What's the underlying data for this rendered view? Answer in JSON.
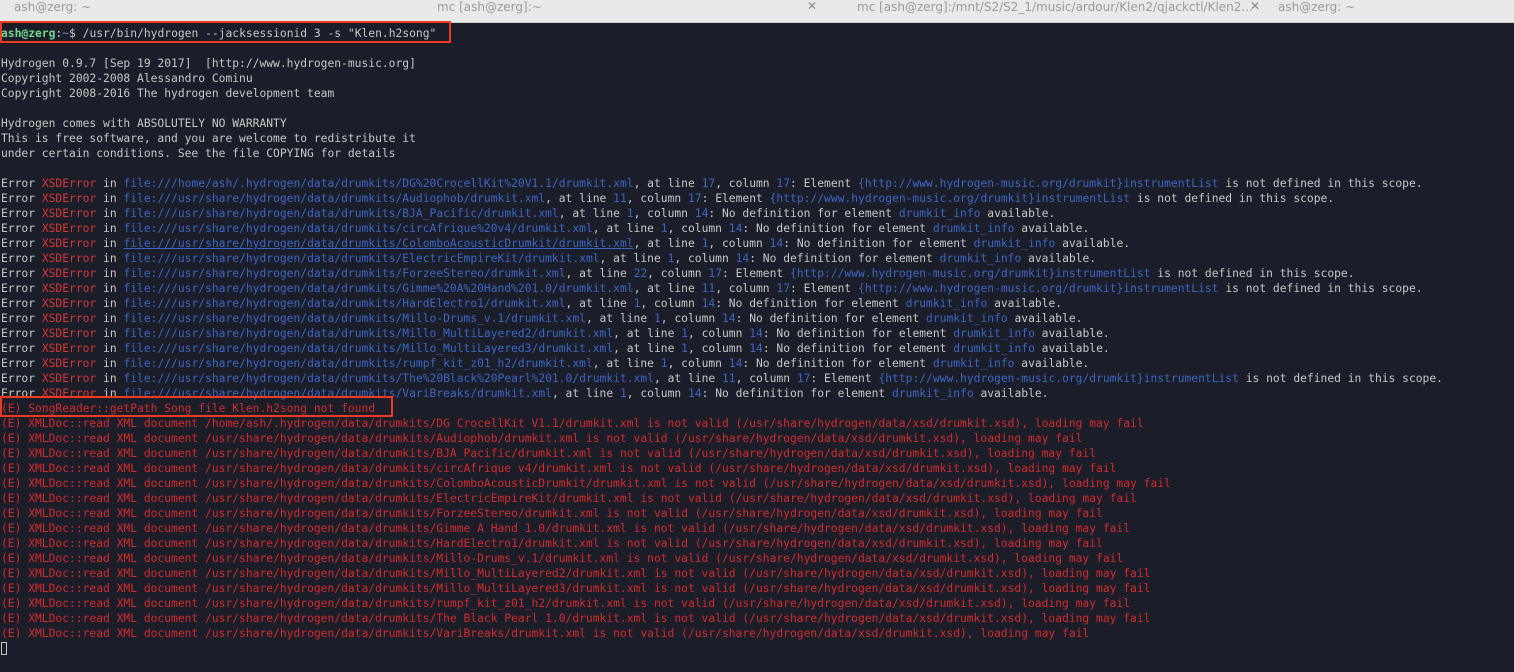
{
  "tabs": [
    {
      "label": "ash@zerg: ~",
      "close": "✕"
    },
    {
      "label": "mc [ash@zerg]:~",
      "close": "✕"
    },
    {
      "label": "mc [ash@zerg]:/mnt/S2/S2_1/music/ardour/Klen2/qjackctl/Klen2...",
      "close": "✕"
    },
    {
      "label": "ash@zerg: ~",
      "close": ""
    }
  ],
  "terminal": {
    "prompt_user": "ash@zerg",
    "prompt_colon": ":",
    "prompt_path": "~",
    "prompt_sym": "$ ",
    "command": "/usr/bin/hydrogen --jacksessionid 3 -s \"Klen.h2song\"",
    "banner": [
      "Hydrogen 0.9.7 [Sep 19 2017]  [http://www.hydrogen-music.org]",
      "Copyright 2002-2008 Alessandro Cominu",
      "Copyright 2008-2016 The hydrogen development team",
      "",
      "Hydrogen comes with ABSOLUTELY NO WARRANTY",
      "This is free software, and you are welcome to redistribute it",
      "under certain conditions. See the file COPYING for details"
    ],
    "errors": [
      {
        "file": "file:///home/ash/.hydrogen/data/drumkits/DG%20CrocellKit%20V1.1/drumkit.xml",
        "line": "17",
        "col": "17",
        "kind": "scope",
        "elem": "{http://www.hydrogen-music.org/drumkit}instrumentList"
      },
      {
        "file": "file:///usr/share/hydrogen/data/drumkits/Audiophob/drumkit.xml",
        "line": "11",
        "col": "17",
        "kind": "scope",
        "elem": "{http://www.hydrogen-music.org/drumkit}instrumentList"
      },
      {
        "file": "file:///usr/share/hydrogen/data/drumkits/BJA_Pacific/drumkit.xml",
        "line": "1",
        "col": "14",
        "kind": "nodef",
        "elem": "drumkit_info"
      },
      {
        "file": "file:///usr/share/hydrogen/data/drumkits/circAfrique%20v4/drumkit.xml",
        "line": "1",
        "col": "14",
        "kind": "nodef",
        "elem": "drumkit_info"
      },
      {
        "file": "file:///usr/share/hydrogen/data/drumkits/ColomboAcousticDrumkit/drumkit.xml",
        "line": "1",
        "col": "14",
        "kind": "nodef",
        "elem": "drumkit_info",
        "link": true
      },
      {
        "file": "file:///usr/share/hydrogen/data/drumkits/ElectricEmpireKit/drumkit.xml",
        "line": "1",
        "col": "14",
        "kind": "nodef",
        "elem": "drumkit_info"
      },
      {
        "file": "file:///usr/share/hydrogen/data/drumkits/ForzeeStereo/drumkit.xml",
        "line": "22",
        "col": "17",
        "kind": "scope",
        "elem": "{http://www.hydrogen-music.org/drumkit}instrumentList"
      },
      {
        "file": "file:///usr/share/hydrogen/data/drumkits/Gimme%20A%20Hand%201.0/drumkit.xml",
        "line": "11",
        "col": "17",
        "kind": "scope",
        "elem": "{http://www.hydrogen-music.org/drumkit}instrumentList"
      },
      {
        "file": "file:///usr/share/hydrogen/data/drumkits/HardElectro1/drumkit.xml",
        "line": "1",
        "col": "14",
        "kind": "nodef",
        "elem": "drumkit_info"
      },
      {
        "file": "file:///usr/share/hydrogen/data/drumkits/Millo-Drums_v.1/drumkit.xml",
        "line": "1",
        "col": "14",
        "kind": "nodef",
        "elem": "drumkit_info"
      },
      {
        "file": "file:///usr/share/hydrogen/data/drumkits/Millo_MultiLayered2/drumkit.xml",
        "line": "1",
        "col": "14",
        "kind": "nodef",
        "elem": "drumkit_info"
      },
      {
        "file": "file:///usr/share/hydrogen/data/drumkits/Millo_MultiLayered3/drumkit.xml",
        "line": "1",
        "col": "14",
        "kind": "nodef",
        "elem": "drumkit_info"
      },
      {
        "file": "file:///usr/share/hydrogen/data/drumkits/rumpf_kit_z01_h2/drumkit.xml",
        "line": "1",
        "col": "14",
        "kind": "nodef",
        "elem": "drumkit_info"
      },
      {
        "file": "file:///usr/share/hydrogen/data/drumkits/The%20Black%20Pearl%201.0/drumkit.xml",
        "line": "11",
        "col": "17",
        "kind": "scope",
        "elem": "{http://www.hydrogen-music.org/drumkit}instrumentList"
      },
      {
        "file": "file:///usr/share/hydrogen/data/drumkits/VariBreaks/drumkit.xml",
        "line": "1",
        "col": "14",
        "kind": "nodef",
        "elem": "drumkit_info"
      }
    ],
    "error_word": "Error ",
    "xsd_word": "XSDError",
    "in_word": " in ",
    "at_line": ", at line ",
    "column_word": ", column ",
    "element_word": ": Element ",
    "not_defined": " is not defined in this scope.",
    "no_def": ": No definition for element ",
    "available": " available.",
    "songreader_line": "(E) SongReader::getPath Song file Klen.h2song not found",
    "xml_prefix": "(E) XMLDoc::read XML document ",
    "xml_suffix": " is not valid (/usr/share/hydrogen/data/xsd/drumkit.xsd), loading may fail",
    "xml_docs": [
      "/home/ash/.hydrogen/data/drumkits/DG CrocellKit V1.1/drumkit.xml",
      "/usr/share/hydrogen/data/drumkits/Audiophob/drumkit.xml",
      "/usr/share/hydrogen/data/drumkits/BJA_Pacific/drumkit.xml",
      "/usr/share/hydrogen/data/drumkits/circAfrique v4/drumkit.xml",
      "/usr/share/hydrogen/data/drumkits/ColomboAcousticDrumkit/drumkit.xml",
      "/usr/share/hydrogen/data/drumkits/ElectricEmpireKit/drumkit.xml",
      "/usr/share/hydrogen/data/drumkits/ForzeeStereo/drumkit.xml",
      "/usr/share/hydrogen/data/drumkits/Gimme A Hand 1.0/drumkit.xml",
      "/usr/share/hydrogen/data/drumkits/HardElectro1/drumkit.xml",
      "/usr/share/hydrogen/data/drumkits/Millo-Drums_v.1/drumkit.xml",
      "/usr/share/hydrogen/data/drumkits/Millo_MultiLayered2/drumkit.xml",
      "/usr/share/hydrogen/data/drumkits/Millo_MultiLayered3/drumkit.xml",
      "/usr/share/hydrogen/data/drumkits/rumpf_kit_z01_h2/drumkit.xml",
      "/usr/share/hydrogen/data/drumkits/The Black Pearl 1.0/drumkit.xml",
      "/usr/share/hydrogen/data/drumkits/VariBreaks/drumkit.xml"
    ]
  },
  "colors": {
    "background": "#1b1e29",
    "text": "#c5c8c6",
    "prompt_user": "#74d98f",
    "prompt_path": "#6a8cd7",
    "error_red": "#d73737",
    "link_blue": "#3b67c4",
    "highlight_box": "#ee3b1f"
  }
}
